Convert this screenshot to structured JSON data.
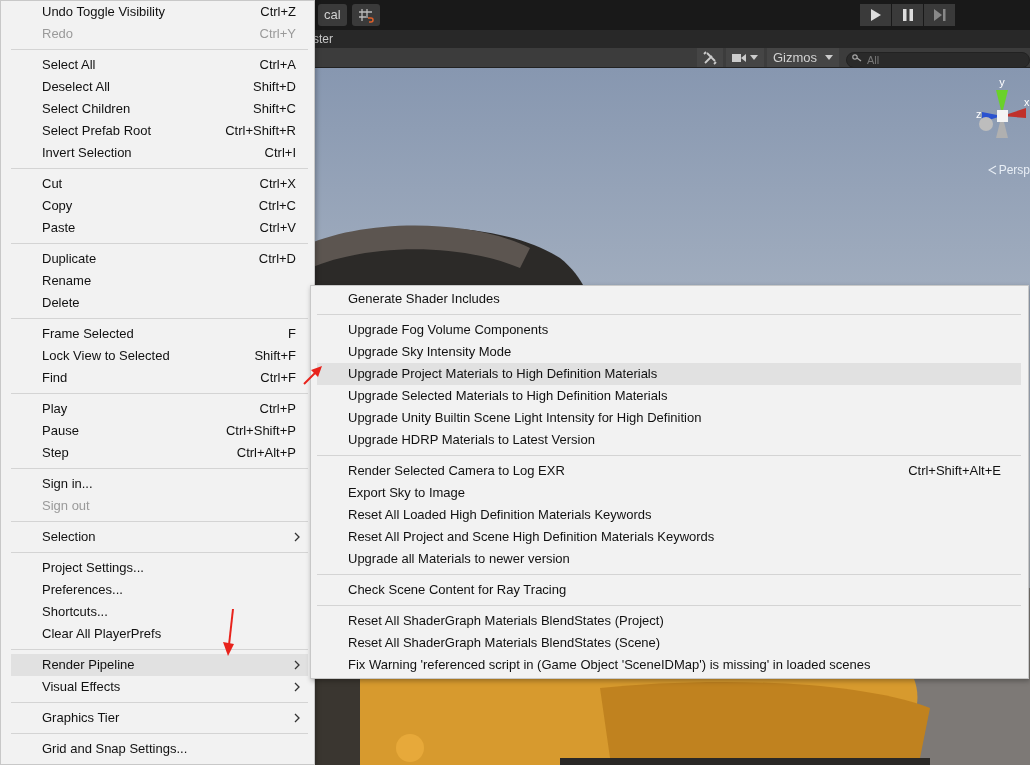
{
  "toolbar": {
    "mode_label": "cal"
  },
  "tab_row": {
    "label": "ster"
  },
  "scene_toolbar": {
    "gizmos_label": "Gizmos",
    "search": {
      "placeholder": "All"
    }
  },
  "gizmo": {
    "axes": [
      "y",
      "z",
      "x"
    ],
    "projection": "Persp"
  },
  "menu": {
    "sections": [
      [
        {
          "label": "Undo Toggle Visibility",
          "shortcut": "Ctrl+Z",
          "disabled": false,
          "selected": false,
          "has_submenu": false
        },
        {
          "label": "Redo",
          "shortcut": "Ctrl+Y",
          "disabled": true,
          "selected": false,
          "has_submenu": false
        }
      ],
      [
        {
          "label": "Select All",
          "shortcut": "Ctrl+A",
          "disabled": false,
          "selected": false,
          "has_submenu": false
        },
        {
          "label": "Deselect All",
          "shortcut": "Shift+D",
          "disabled": false,
          "selected": false,
          "has_submenu": false
        },
        {
          "label": "Select Children",
          "shortcut": "Shift+C",
          "disabled": false,
          "selected": false,
          "has_submenu": false
        },
        {
          "label": "Select Prefab Root",
          "shortcut": "Ctrl+Shift+R",
          "disabled": false,
          "selected": false,
          "has_submenu": false
        },
        {
          "label": "Invert Selection",
          "shortcut": "Ctrl+I",
          "disabled": false,
          "selected": false,
          "has_submenu": false
        }
      ],
      [
        {
          "label": "Cut",
          "shortcut": "Ctrl+X",
          "disabled": false,
          "selected": false,
          "has_submenu": false
        },
        {
          "label": "Copy",
          "shortcut": "Ctrl+C",
          "disabled": false,
          "selected": false,
          "has_submenu": false
        },
        {
          "label": "Paste",
          "shortcut": "Ctrl+V",
          "disabled": false,
          "selected": false,
          "has_submenu": false
        }
      ],
      [
        {
          "label": "Duplicate",
          "shortcut": "Ctrl+D",
          "disabled": false,
          "selected": false,
          "has_submenu": false
        },
        {
          "label": "Rename",
          "disabled": false,
          "selected": false,
          "has_submenu": false
        },
        {
          "label": "Delete",
          "disabled": false,
          "selected": false,
          "has_submenu": false
        }
      ],
      [
        {
          "label": "Frame Selected",
          "shortcut": "F",
          "disabled": false,
          "selected": false,
          "has_submenu": false
        },
        {
          "label": "Lock View to Selected",
          "shortcut": "Shift+F",
          "disabled": false,
          "selected": false,
          "has_submenu": false
        },
        {
          "label": "Find",
          "shortcut": "Ctrl+F",
          "disabled": false,
          "selected": false,
          "has_submenu": false
        }
      ],
      [
        {
          "label": "Play",
          "shortcut": "Ctrl+P",
          "disabled": false,
          "selected": false,
          "has_submenu": false
        },
        {
          "label": "Pause",
          "shortcut": "Ctrl+Shift+P",
          "disabled": false,
          "selected": false,
          "has_submenu": false
        },
        {
          "label": "Step",
          "shortcut": "Ctrl+Alt+P",
          "disabled": false,
          "selected": false,
          "has_submenu": false
        }
      ],
      [
        {
          "label": "Sign in...",
          "disabled": false,
          "selected": false,
          "has_submenu": false
        },
        {
          "label": "Sign out",
          "disabled": true,
          "selected": false,
          "has_submenu": false
        }
      ],
      [
        {
          "label": "Selection",
          "disabled": false,
          "selected": false,
          "has_submenu": true
        }
      ],
      [
        {
          "label": "Project Settings...",
          "disabled": false,
          "selected": false,
          "has_submenu": false
        },
        {
          "label": "Preferences...",
          "disabled": false,
          "selected": false,
          "has_submenu": false
        },
        {
          "label": "Shortcuts...",
          "disabled": false,
          "selected": false,
          "has_submenu": false
        },
        {
          "label": "Clear All PlayerPrefs",
          "disabled": false,
          "selected": false,
          "has_submenu": false
        }
      ],
      [
        {
          "label": "Render Pipeline",
          "disabled": false,
          "selected": true,
          "has_submenu": true
        },
        {
          "label": "Visual Effects",
          "disabled": false,
          "selected": false,
          "has_submenu": true
        }
      ],
      [
        {
          "label": "Graphics Tier",
          "disabled": false,
          "selected": false,
          "has_submenu": true
        }
      ],
      [
        {
          "label": "Grid and Snap Settings...",
          "disabled": false,
          "selected": false,
          "has_submenu": false
        }
      ]
    ]
  },
  "submenu": {
    "sections": [
      [
        {
          "label": "Generate Shader Includes",
          "selected": false
        }
      ],
      [
        {
          "label": "Upgrade Fog Volume Components",
          "selected": false
        },
        {
          "label": "Upgrade Sky Intensity Mode",
          "selected": false
        },
        {
          "label": "Upgrade Project Materials to High Definition Materials",
          "selected": true
        },
        {
          "label": "Upgrade Selected Materials to High Definition Materials",
          "selected": false
        },
        {
          "label": "Upgrade Unity Builtin Scene Light Intensity for High Definition",
          "selected": false
        },
        {
          "label": "Upgrade HDRP Materials to Latest Version",
          "selected": false
        }
      ],
      [
        {
          "label": "Render Selected Camera to Log EXR",
          "shortcut": "Ctrl+Shift+Alt+E",
          "selected": false
        },
        {
          "label": "Export Sky to Image",
          "selected": false
        },
        {
          "label": "Reset All Loaded High Definition Materials Keywords",
          "selected": false
        },
        {
          "label": "Reset All Project and Scene High Definition Materials Keywords",
          "selected": false
        },
        {
          "label": "Upgrade all Materials to newer version",
          "selected": false
        }
      ],
      [
        {
          "label": "Check Scene Content for Ray Tracing",
          "selected": false
        }
      ],
      [
        {
          "label": "Reset All ShaderGraph Materials BlendStates (Project)",
          "selected": false
        },
        {
          "label": "Reset All ShaderGraph Materials BlendStates (Scene)",
          "selected": false
        },
        {
          "label": "Fix Warning 'referenced script in (Game Object 'SceneIDMap') is missing' in loaded scenes",
          "selected": false
        }
      ]
    ]
  }
}
